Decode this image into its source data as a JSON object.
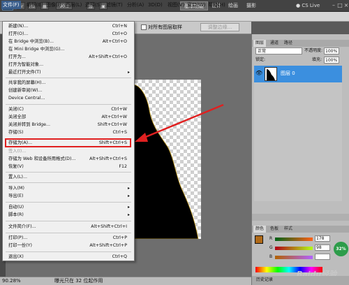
{
  "app": {
    "logo": "Ps",
    "zoom_field": "90.3",
    "workspace_basic": "基本功能",
    "workspace_design": "设计",
    "workspace_paint": "绘画",
    "workspace_photo": "摄影",
    "cs_live": "CS Live"
  },
  "menubar": {
    "items": [
      "文件(F)",
      "编辑(E)",
      "图像(I)",
      "图层(L)",
      "选择(S)",
      "滤镜(T)",
      "分析(A)",
      "3D(D)",
      "视图(V)",
      "窗口(W)",
      "帮助(H)"
    ]
  },
  "options": {
    "sample_all": "对所有图层取样",
    "adjust_edge": "调整边缘..."
  },
  "file_menu": [
    {
      "label": "新建(N)...",
      "shortcut": "Ctrl+N"
    },
    {
      "label": "打开(O)...",
      "shortcut": "Ctrl+O"
    },
    {
      "label": "在 Bridge 中浏览(B)...",
      "shortcut": "Alt+Ctrl+O"
    },
    {
      "label": "在 Mini Bridge 中浏览(G)...",
      "shortcut": ""
    },
    {
      "label": "打开为...",
      "shortcut": "Alt+Shift+Ctrl+O"
    },
    {
      "label": "打开为智能对象...",
      "shortcut": ""
    },
    {
      "label": "最近打开文件(T)",
      "shortcut": "",
      "arrow": "▸"
    },
    {
      "label": "共享我的屏幕(H)...",
      "shortcut": ""
    },
    {
      "label": "创建新审阅(W)...",
      "shortcut": ""
    },
    {
      "label": "Device Central...",
      "shortcut": ""
    },
    {
      "label": "关闭(C)",
      "shortcut": "Ctrl+W"
    },
    {
      "label": "关闭全部",
      "shortcut": "Alt+Ctrl+W"
    },
    {
      "label": "关闭并转到 Bridge...",
      "shortcut": "Shift+Ctrl+W"
    },
    {
      "label": "存储(S)",
      "shortcut": "Ctrl+S"
    },
    {
      "label": "存储为(A)...",
      "shortcut": "Shift+Ctrl+S"
    },
    {
      "label": "签入(I)...",
      "shortcut": ""
    },
    {
      "label": "存储为 Web 和设备所用格式(D)...",
      "shortcut": "Alt+Shift+Ctrl+S"
    },
    {
      "label": "恢复(V)",
      "shortcut": "F12"
    },
    {
      "label": "置入(L)...",
      "shortcut": ""
    },
    {
      "label": "导入(M)",
      "shortcut": "",
      "arrow": "▸"
    },
    {
      "label": "导出(E)",
      "shortcut": "",
      "arrow": "▸"
    },
    {
      "label": "自动(U)",
      "shortcut": "",
      "arrow": "▸"
    },
    {
      "label": "脚本(R)",
      "shortcut": "",
      "arrow": "▸"
    },
    {
      "label": "文件简介(F)...",
      "shortcut": "Alt+Shift+Ctrl+I"
    },
    {
      "label": "打印(P)...",
      "shortcut": "Ctrl+P"
    },
    {
      "label": "打印一份(Y)",
      "shortcut": "Alt+Shift+Ctrl+P"
    },
    {
      "label": "退出(X)",
      "shortcut": "Ctrl+Q"
    }
  ],
  "layers": {
    "tabs": [
      "图层",
      "通道",
      "路径"
    ],
    "blend_mode": "正常",
    "opacity_label": "不透明度:",
    "opacity": "100%",
    "lock_label": "锁定:",
    "fill_label": "填充:",
    "fill": "100%",
    "layer_name": "图层 0"
  },
  "color": {
    "tabs": [
      "颜色",
      "色板",
      "样式"
    ],
    "r_label": "R",
    "g_label": "G",
    "b_label": "B",
    "r": "178",
    "g": "98",
    "b": "",
    "swatch_color": "#b06a18"
  },
  "history_tab": "历史记录",
  "status": {
    "zoom": "90.28%",
    "doc": "曝光只在 32 位起作用"
  },
  "badge": "32%",
  "watermark": "Baidu经验",
  "colors": {
    "accent": "#3b8fdf",
    "highlight": "#e02020",
    "arrow": "#e02020"
  }
}
